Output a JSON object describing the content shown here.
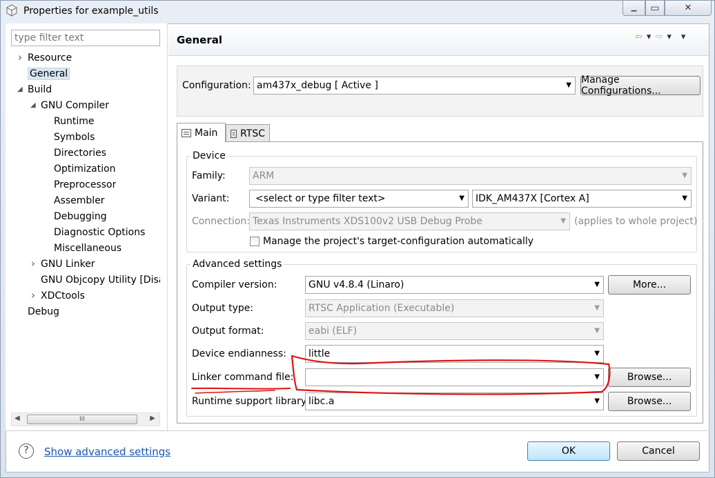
{
  "window": {
    "title": "Properties for example_utils",
    "close_glyph": "✕",
    "max_glyph": "▭",
    "min_glyph": "▁"
  },
  "sidebar": {
    "filter_placeholder": "type filter text",
    "items": [
      {
        "label": "Resource",
        "arrow": "›"
      },
      {
        "label": "General",
        "arrow": ""
      },
      {
        "label": "Build",
        "arrow": "◢"
      },
      {
        "label": "GNU Compiler",
        "arrow": "◢"
      },
      {
        "label": "Runtime",
        "arrow": ""
      },
      {
        "label": "Symbols",
        "arrow": ""
      },
      {
        "label": "Directories",
        "arrow": ""
      },
      {
        "label": "Optimization",
        "arrow": ""
      },
      {
        "label": "Preprocessor",
        "arrow": ""
      },
      {
        "label": "Assembler",
        "arrow": ""
      },
      {
        "label": "Debugging",
        "arrow": ""
      },
      {
        "label": "Diagnostic Options",
        "arrow": ""
      },
      {
        "label": "Miscellaneous",
        "arrow": ""
      },
      {
        "label": "GNU Linker",
        "arrow": "›"
      },
      {
        "label": "GNU Objcopy Utility  [Disa",
        "arrow": ""
      },
      {
        "label": "XDCtools",
        "arrow": "›"
      },
      {
        "label": "Debug",
        "arrow": ""
      }
    ],
    "scroll_thumb": "III"
  },
  "page": {
    "title": "General",
    "nav_back": "⇦",
    "nav_forward": "⇨",
    "nav_dropdown": "▾"
  },
  "config": {
    "label": "Configuration:",
    "value": "am437x_debug  [ Active ]",
    "manage_button": "Manage Configurations..."
  },
  "tabs": [
    {
      "label": "Main",
      "active": true
    },
    {
      "label": "RTSC",
      "active": false
    }
  ],
  "device": {
    "title": "Device",
    "family_label": "Family:",
    "family_value": "ARM",
    "variant_label": "Variant:",
    "variant_filter": "<select or type filter text>",
    "variant_value": "IDK_AM437X [Cortex A]",
    "connection_label": "Connection:",
    "connection_value": "Texas Instruments XDS100v2 USB Debug Probe",
    "connection_note": "(applies to whole project)",
    "manage_checkbox_label": "Manage the project's target-configuration automatically"
  },
  "advanced": {
    "title": "Advanced settings",
    "compiler_label": "Compiler version:",
    "compiler_value": "GNU v4.8.4 (Linaro)",
    "more_button": "More...",
    "output_type_label": "Output type:",
    "output_type_value": "RTSC Application (Executable)",
    "output_format_label": "Output format:",
    "output_format_value": "eabi (ELF)",
    "endianness_label": "Device endianness:",
    "endianness_value": "little",
    "linker_label": "Linker command file:",
    "linker_value": "",
    "linker_browse": "Browse...",
    "runtime_label": "Runtime support library:",
    "runtime_value": "libc.a",
    "runtime_browse": "Browse..."
  },
  "footer": {
    "help_glyph": "?",
    "advanced_link": "Show advanced settings",
    "ok_button": "OK",
    "cancel_button": "Cancel"
  },
  "colors": {
    "link": "#1a56b0",
    "annotation": "#e01010",
    "selection": "#dbe6f4"
  }
}
